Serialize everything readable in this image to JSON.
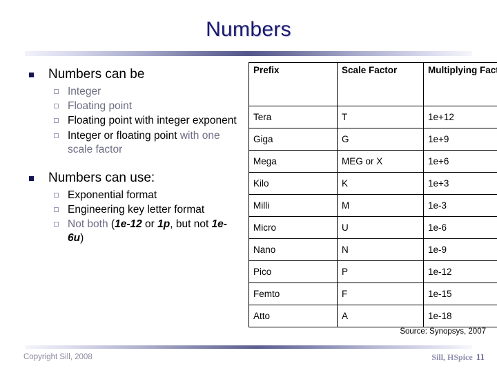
{
  "slide": {
    "title": "Numbers",
    "page_number": "11"
  },
  "left": {
    "section1": {
      "heading": "Numbers can be",
      "items": [
        {
          "plain": "Integer",
          "style": "muted"
        },
        {
          "plain": "Floating point",
          "style": "muted"
        },
        {
          "plain": "Floating point with integer exponent",
          "style": "black"
        },
        {
          "black_part": "Integer or floating point ",
          "muted_part": "with one scale factor",
          "style": "mixed"
        }
      ]
    },
    "section2": {
      "heading": "Numbers can use:",
      "items": [
        {
          "plain": "Exponential format",
          "style": "black"
        },
        {
          "plain": "Engineering key letter format",
          "style": "black"
        },
        {
          "style": "rich",
          "muted_lead": "Not both",
          "text_a": " (",
          "italic_a": "1e-12",
          "text_b": " or ",
          "italic_b": "1p",
          "text_c": ", but not ",
          "italic_c": "1e-6u",
          "text_d": ")"
        }
      ]
    }
  },
  "table": {
    "headers": [
      "Prefix",
      "Scale Factor",
      "Multiplying Factor"
    ],
    "rows": [
      [
        "Tera",
        "T",
        "1e+12"
      ],
      [
        "Giga",
        "G",
        "1e+9"
      ],
      [
        "Mega",
        "MEG or X",
        "1e+6"
      ],
      [
        "Kilo",
        "K",
        "1e+3"
      ],
      [
        "Milli",
        "M",
        "1e-3"
      ],
      [
        "Micro",
        "U",
        "1e-6"
      ],
      [
        "Nano",
        "N",
        "1e-9"
      ],
      [
        "Pico",
        "P",
        "1e-12"
      ],
      [
        "Femto",
        "F",
        "1e-15"
      ],
      [
        "Atto",
        "A",
        "1e-18"
      ]
    ]
  },
  "source_note": "Source: Synopsys, 2007",
  "footer": {
    "copyright": "Copyright Sill, 2008",
    "deck_label": "Sill, HSpice"
  },
  "colors": {
    "title": "#1a1a70",
    "accent_bar": "#53568a",
    "muted_text": "#6d6d84",
    "bullet_l1": "#141452",
    "bullet_l2": "#9a9ab4"
  }
}
